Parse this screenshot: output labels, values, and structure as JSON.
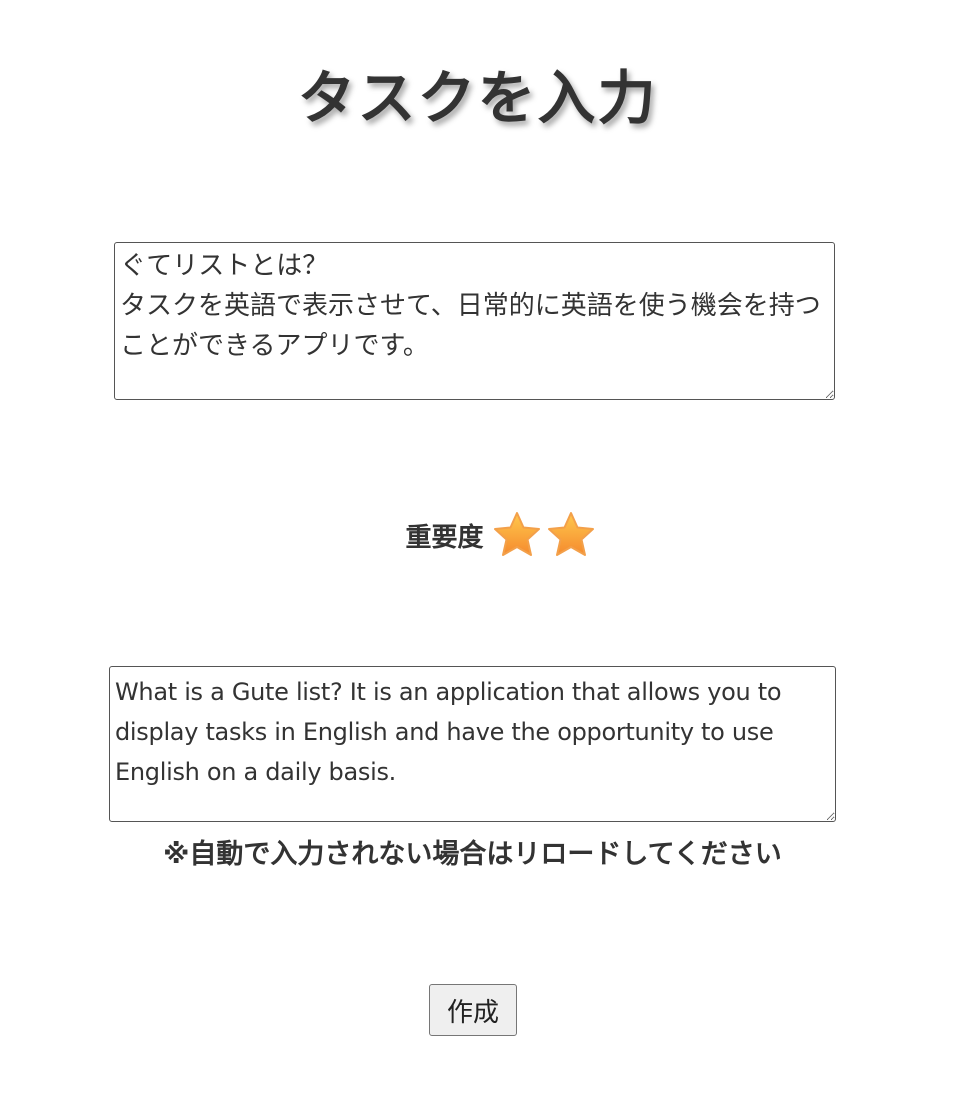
{
  "header": {
    "title": "タスクを入力"
  },
  "form": {
    "task_japanese": "ぐてリストとは？\nタスクを英語で表示させて、日常的に英語を使う機会を持つことができるアプリです。",
    "importance": {
      "label": "重要度",
      "stars": 2,
      "star_icon": "star-icon",
      "star_color": "#f7a53a"
    },
    "task_english": "What is a Gute list? It is an application that allows you to display tasks in English and have the opportunity to use English on a daily basis.",
    "notice": "※自動で入力されない場合はリロードしてください",
    "submit_label": "作成"
  }
}
